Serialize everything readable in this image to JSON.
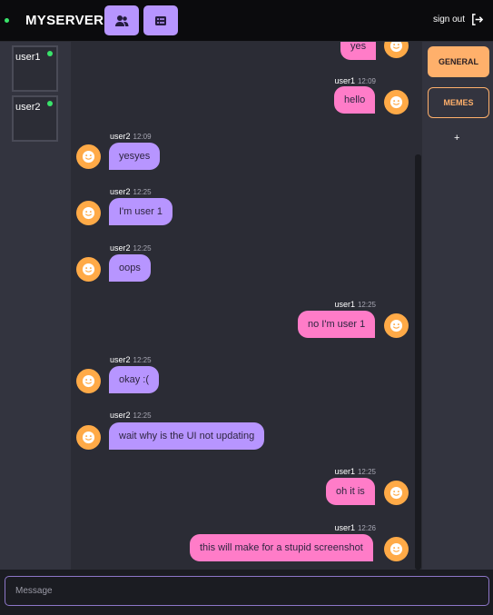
{
  "header": {
    "server_name": "MYSERVER",
    "sign_out_label": "sign out",
    "members_icon": "users-icon",
    "channels_icon": "list-icon"
  },
  "users": [
    {
      "name": "user1",
      "status": "online"
    },
    {
      "name": "user2",
      "status": "online"
    }
  ],
  "messages": [
    {
      "user": "",
      "time": "",
      "text": "yes",
      "side": "outgoing"
    },
    {
      "user": "user1",
      "time": "12:09",
      "text": "hello",
      "side": "outgoing"
    },
    {
      "user": "user2",
      "time": "12:09",
      "text": "yesyes",
      "side": "incoming"
    },
    {
      "user": "user2",
      "time": "12:25",
      "text": "I'm user 1",
      "side": "incoming"
    },
    {
      "user": "user2",
      "time": "12:25",
      "text": "oops",
      "side": "incoming"
    },
    {
      "user": "user1",
      "time": "12:25",
      "text": "no I'm user 1",
      "side": "outgoing"
    },
    {
      "user": "user2",
      "time": "12:25",
      "text": "okay :(",
      "side": "incoming"
    },
    {
      "user": "user2",
      "time": "12:25",
      "text": "wait why is the UI not updating",
      "side": "incoming"
    },
    {
      "user": "user1",
      "time": "12:25",
      "text": "oh it is",
      "side": "outgoing"
    },
    {
      "user": "user1",
      "time": "12:26",
      "text": "this will make for a stupid screenshot",
      "side": "outgoing"
    }
  ],
  "channels": [
    {
      "name": "GENERAL",
      "active": true
    },
    {
      "name": "MEMES",
      "active": false
    }
  ],
  "add_channel_label": "+",
  "composer": {
    "placeholder": "Message"
  },
  "colors": {
    "incoming_bubble": "#b795ff",
    "outgoing_bubble": "#ff7cc8",
    "avatar": "#ffaa47",
    "channel_accent": "#ffb06b",
    "online": "#39e36a"
  }
}
